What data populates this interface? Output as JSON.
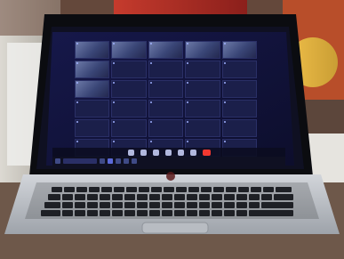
{
  "photo": {
    "kind": "photo-of-laptop-screen",
    "colors": {
      "background": "#6a5040",
      "laptop_body": "#bfc2c7",
      "bezel": "#0b0c10",
      "screen_bg": "#121436",
      "accent_red": "#ff3b30"
    }
  },
  "conference": {
    "participants": [
      {
        "name": "",
        "type": "video"
      },
      {
        "name": "",
        "type": "video"
      },
      {
        "name": "",
        "type": "video"
      },
      {
        "name": "",
        "type": "video"
      },
      {
        "name": "",
        "type": "video"
      },
      {
        "name": "",
        "type": "video"
      },
      {
        "name": "",
        "type": "tile"
      },
      {
        "name": "",
        "type": "tile"
      },
      {
        "name": "",
        "type": "tile"
      },
      {
        "name": "",
        "type": "tile"
      },
      {
        "name": "",
        "type": "video"
      },
      {
        "name": "",
        "type": "tile"
      },
      {
        "name": "",
        "type": "tile"
      },
      {
        "name": "",
        "type": "tile"
      },
      {
        "name": "",
        "type": "tile"
      },
      {
        "name": "",
        "type": "tile"
      },
      {
        "name": "",
        "type": "tile"
      },
      {
        "name": "",
        "type": "tile"
      },
      {
        "name": "",
        "type": "tile"
      },
      {
        "name": "",
        "type": "tile"
      },
      {
        "name": "",
        "type": "tile"
      },
      {
        "name": "",
        "type": "tile"
      },
      {
        "name": "",
        "type": "tile"
      },
      {
        "name": "",
        "type": "tile"
      },
      {
        "name": "",
        "type": "tile"
      },
      {
        "name": "",
        "type": "tile"
      },
      {
        "name": "",
        "type": "tile"
      },
      {
        "name": "",
        "type": "tile"
      },
      {
        "name": "",
        "type": "tile"
      },
      {
        "name": "",
        "type": "tile"
      }
    ],
    "topbar": {
      "left": "",
      "right": ""
    }
  }
}
